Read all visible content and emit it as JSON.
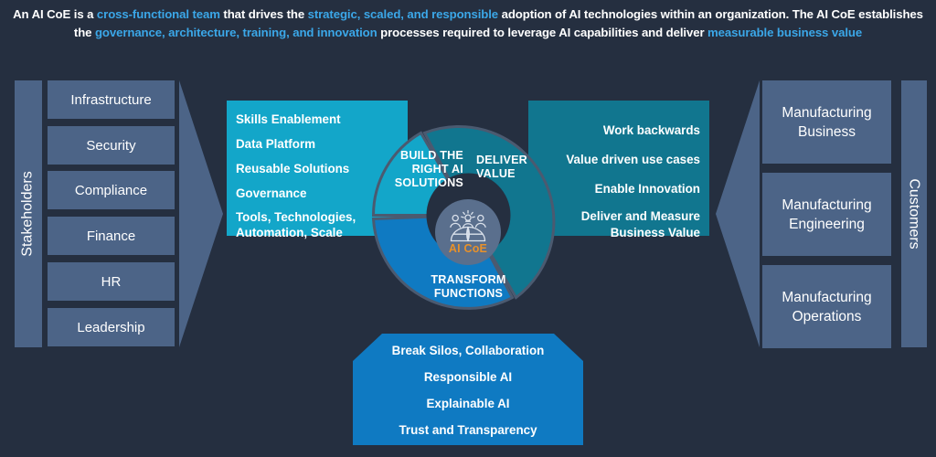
{
  "header": {
    "segments": [
      {
        "text": "An AI CoE is a ",
        "highlight": false
      },
      {
        "text": "cross-functional team",
        "highlight": true
      },
      {
        "text": " that drives the ",
        "highlight": false
      },
      {
        "text": "strategic, scaled, and responsible",
        "highlight": true
      },
      {
        "text": " adoption of AI technologies within an organization. The AI CoE establishes the ",
        "highlight": false
      },
      {
        "text": "governance, architecture, training, and innovation",
        "highlight": true
      },
      {
        "text": " processes required to leverage AI capabilities and deliver ",
        "highlight": false
      },
      {
        "text": "measurable business value",
        "highlight": true
      }
    ],
    "plain_text": "An AI CoE is a cross-functional team that drives the strategic, scaled, and responsible adoption of AI technologies within an organization. The AI CoE establishes the governance, architecture, training, and innovation processes required to leverage AI capabilities and deliver measurable business value"
  },
  "left": {
    "axis_label": "Stakeholders",
    "items": [
      {
        "label": "Infrastructure"
      },
      {
        "label": "Security"
      },
      {
        "label": "Compliance"
      },
      {
        "label": "Finance"
      },
      {
        "label": "HR"
      },
      {
        "label": "Leadership"
      }
    ]
  },
  "right": {
    "axis_label": "Customers",
    "items": [
      {
        "label": "Manufacturing Business"
      },
      {
        "label": "Manufacturing Engineering"
      },
      {
        "label": "Manufacturing Operations"
      }
    ]
  },
  "hub": {
    "label": "AI CoE",
    "icon": "people-globe-idea-icon",
    "color": "#e8912a"
  },
  "wheel": {
    "segments": [
      {
        "id": "build",
        "title_line1": "BUILD  THE",
        "title_line2": "RIGHT AI",
        "title_line3": "SOLUTIONS",
        "color": "#13a6c9",
        "panel_items": [
          "Skills Enablement",
          "Data Platform",
          "Reusable Solutions",
          "Governance"
        ],
        "panel_item_multiline": [
          "Tools, Technologies,",
          "Automation, Scale"
        ]
      },
      {
        "id": "deliver",
        "title_line1": "DELIVER",
        "title_line2": "VALUE",
        "color": "#11768f",
        "panel_items": [
          "Work backwards",
          "Value driven use cases",
          "Enable Innovation"
        ],
        "panel_item_multiline": [
          "Deliver and Measure",
          "Business Value"
        ]
      },
      {
        "id": "transform",
        "title_line1": "TRANSFORM",
        "title_line2": "FUNCTIONS",
        "color": "#0f7ac2",
        "panel_items": [
          "Break Silos, Collaboration",
          "Responsible AI",
          "Explainable AI",
          "Trust and Transparency"
        ]
      }
    ]
  },
  "theme": {
    "background": "#252f40",
    "box_fill": "#4c6487",
    "arrow_fill": "#4c6487",
    "highlight_text": "#3ba7e8",
    "body_text": "#ffffff"
  }
}
